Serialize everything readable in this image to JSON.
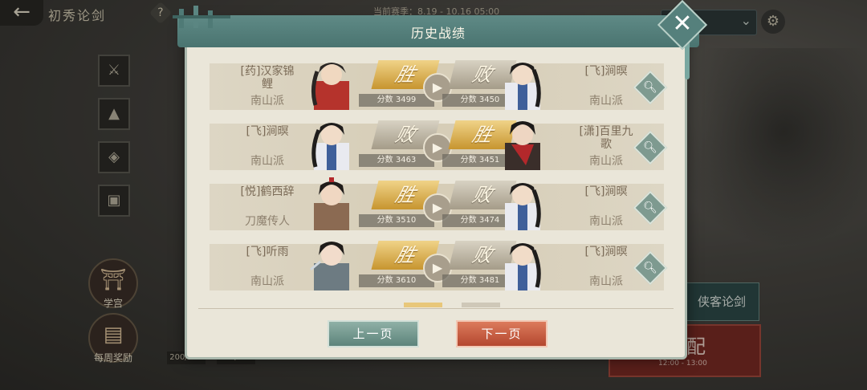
{
  "header": {
    "back_icon": "back-arrow-icon",
    "page_title": "初秀论剑",
    "help_label": "?",
    "season_text": "当前赛季：8.19 - 10.16 05:00"
  },
  "modal": {
    "title": "历史战绩",
    "close_label": "✕",
    "prev_label": "上一页",
    "next_label": "下一页",
    "matches": [
      {
        "left": {
          "name": "[药]汉家锦鲤",
          "sect": "南山派",
          "result": "胜",
          "score": "分数 3499"
        },
        "right": {
          "name": "[飞]涧暝",
          "sect": "南山派",
          "result": "败",
          "score": "分数 3450"
        }
      },
      {
        "left": {
          "name": "[飞]涧暝",
          "sect": "南山派",
          "result": "败",
          "score": "分数 3463"
        },
        "right": {
          "name": "[潇]百里九歌",
          "sect": "南山派",
          "result": "胜",
          "score": "分数 3451"
        }
      },
      {
        "left": {
          "name": "[悦]鹤西辞",
          "sect": "刀魔传人",
          "result": "胜",
          "score": "分数 3510"
        },
        "right": {
          "name": "[飞]涧暝",
          "sect": "南山派",
          "result": "败",
          "score": "分数 3474"
        }
      },
      {
        "left": {
          "name": "[飞]听雨",
          "sect": "南山派",
          "result": "胜",
          "score": "分数 3610"
        },
        "right": {
          "name": "[飞]涧暝",
          "sect": "南山派",
          "result": "败",
          "score": "分数 3481"
        }
      }
    ]
  },
  "side": {
    "building_label": "学宫",
    "reward_label": "每周奖励",
    "counter1": "200/200",
    "counter2": "20/20"
  },
  "right_panel": {
    "xiake_label": "侠客论剑",
    "match_label": "配",
    "match_time": "12:00 - 13:00"
  },
  "colors": {
    "modal_header": "#5f8a86",
    "win_gold": "#c7952f",
    "lose_gray": "#a59c89",
    "next_button": "#b4472f"
  }
}
